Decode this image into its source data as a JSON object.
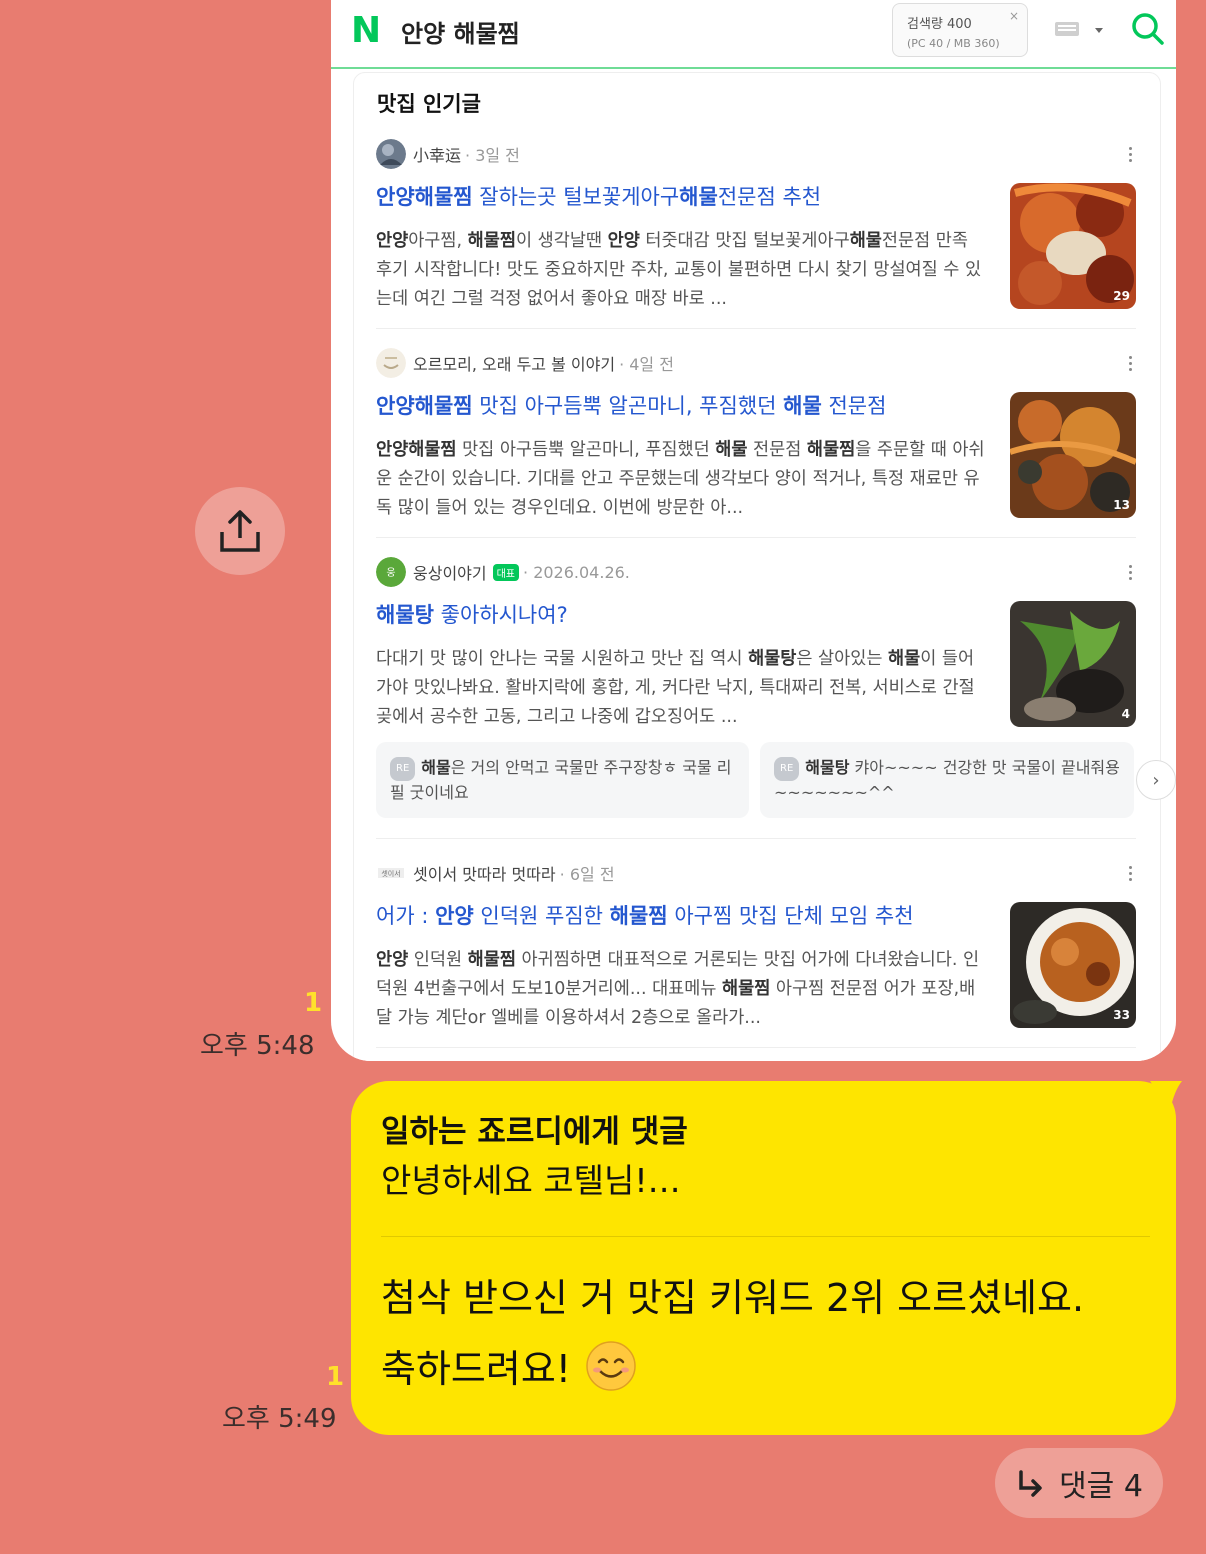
{
  "search_screenshot": {
    "logo": "N",
    "query": "안양 해물찜",
    "search_volume": {
      "line1": "검색량 400",
      "line2": "(PC 40 / MB 360)",
      "close": "×"
    },
    "section_title": "맛집 인기글",
    "posts": [
      {
        "author": "小幸运",
        "ago": "· 3일 전",
        "title_parts": [
          {
            "t": "안양해물찜",
            "b": true
          },
          {
            "t": " 잘하는곳 털보꽃게아구",
            "b": false
          },
          {
            "t": "해물",
            "b": true
          },
          {
            "t": "전문점 추천",
            "b": false
          }
        ],
        "body_parts": [
          {
            "t": "안양",
            "b": true
          },
          {
            "t": "아구찜, ",
            "b": false
          },
          {
            "t": "해물찜",
            "b": true
          },
          {
            "t": "이 생각날땐 ",
            "b": false
          },
          {
            "t": "안양",
            "b": true
          },
          {
            "t": " 터줏대감 맛집 털보꽃게아구",
            "b": false
          },
          {
            "t": "해물",
            "b": true
          },
          {
            "t": "전문점 만족 후기 시작합니다! 맛도 중요하지만 주차, 교통이 불편하면 다시 찾기 망설여질 수 있는데 여긴 그럴 걱정 없어서 좋아요 매장 바로 ...",
            "b": false
          }
        ],
        "image_count": "29"
      },
      {
        "author": "오르모리, 오래 두고 볼 이야기",
        "ago": "· 4일 전",
        "title_parts": [
          {
            "t": "안양해물찜",
            "b": true
          },
          {
            "t": " 맛집 아구듬뿍 알곤마니, 푸짐했던 ",
            "b": false
          },
          {
            "t": "해물",
            "b": true
          },
          {
            "t": " 전문점",
            "b": false
          }
        ],
        "body_parts": [
          {
            "t": "안양해물찜",
            "b": true
          },
          {
            "t": " 맛집 아구듬뿍 알곤마니, 푸짐했던 ",
            "b": false
          },
          {
            "t": "해물",
            "b": true
          },
          {
            "t": " 전문점 ",
            "b": false
          },
          {
            "t": "해물찜",
            "b": true
          },
          {
            "t": "을 주문할 때 아쉬운 순간이 있습니다. 기대를 안고 주문했는데 생각보다 양이 적거나, 특정 재료만 유독 많이 들어 있는 경우인데요. 이번에 방문한 아...",
            "b": false
          }
        ],
        "image_count": "13"
      },
      {
        "author": "웅상이야기",
        "badge": "대표",
        "ago": "· 2026.04.26.",
        "title_parts": [
          {
            "t": "해물탕",
            "b": true
          },
          {
            "t": " 좋아하시나여?",
            "b": false
          }
        ],
        "body_parts": [
          {
            "t": "다대기 맛 많이 안나는 국물 시원하고 맛난 집 역시 ",
            "b": false
          },
          {
            "t": "해물탕",
            "b": true
          },
          {
            "t": "은 살아있는 ",
            "b": false
          },
          {
            "t": "해물",
            "b": true
          },
          {
            "t": "이 들어가야 맛있나봐요. 활바지락에 홍합, 게, 커다란 낙지, 특대짜리 전복, 서비스로 간절곶에서 공수한 고동, 그리고 나중에 갑오징어도 ...",
            "b": false
          }
        ],
        "image_count": "4"
      },
      {
        "author": "셋이서 맛따라 멋따라",
        "ago": "· 6일 전",
        "title_parts": [
          {
            "t": "어가 : ",
            "b": false
          },
          {
            "t": "안양",
            "b": true
          },
          {
            "t": " 인덕원 푸짐한 ",
            "b": false
          },
          {
            "t": "해물찜",
            "b": true
          },
          {
            "t": " 아구찜 맛집 단체 모임 추천",
            "b": false
          }
        ],
        "body_parts": [
          {
            "t": "안양",
            "b": true
          },
          {
            "t": " 인덕원 ",
            "b": false
          },
          {
            "t": "해물찜",
            "b": true
          },
          {
            "t": " 아귀찜하면 대표적으로 거론되는 맛집 어가에 다녀왔습니다. 인덕원 4번출구에서 도보10분거리에... 대표메뉴 ",
            "b": false
          },
          {
            "t": "해물찜",
            "b": true
          },
          {
            "t": " 아구찜 전문점 어가 포장,배달 가능 계단or 엘베를 이용하셔서 2층으로 올라가...",
            "b": false
          }
        ],
        "image_count": "33"
      }
    ],
    "replies": [
      {
        "tag": "RE",
        "parts": [
          {
            "t": "해물",
            "b": true
          },
          {
            "t": "은 거의 안먹고 국물만 주구장창ㅎ 국물 리필 굿이네요",
            "b": false
          }
        ]
      },
      {
        "tag": "RE",
        "parts": [
          {
            "t": "해물탕",
            "b": true
          },
          {
            "t": " 캬아~~~~ 건강한 맛 국물이 끝내줘용~~~~~~~^^",
            "b": false
          }
        ]
      }
    ]
  },
  "chat": {
    "msg1_unread": "1",
    "msg1_time": "오후 5:48",
    "msg2_unread": "1",
    "msg2_time": "오후 5:49",
    "reply_title": "일하는 죠르디에게 댓글",
    "reply_preview": "안녕하세요 코텔님!…",
    "message_line1": "첨삭 받으신 거 맛집 키워드 2위 오르셨네요.",
    "message_line2": "축하드려요!",
    "reply_count_label": "댓글 4"
  },
  "colors": {
    "background": "#e87c70",
    "bubble": "#fee500",
    "naver_green": "#03c75a",
    "link_blue": "#2457cf",
    "unread": "#ffe12a"
  },
  "icons": [
    "share-icon",
    "search-icon",
    "keyboard-icon",
    "kebab-menu-icon",
    "chevron-right-icon",
    "reply-arrow-icon",
    "smile-emoji-icon"
  ]
}
